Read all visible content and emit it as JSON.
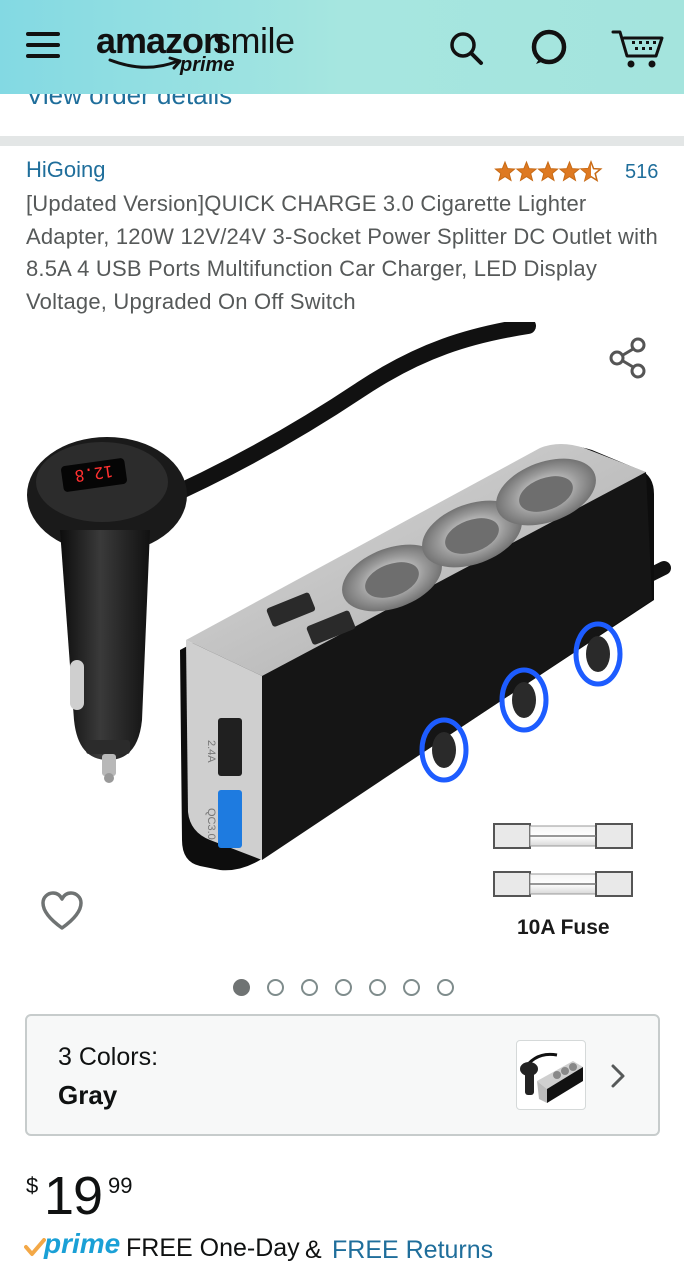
{
  "header": {
    "logo_main": "amazon",
    "logo_smile": "smile",
    "logo_prime": "prime",
    "background": "#a6e6e0",
    "icons": [
      "hamburger-menu-icon",
      "search-icon",
      "alexa-icon",
      "cart-icon"
    ]
  },
  "order_link": "View order details",
  "product": {
    "brand": "HiGoing",
    "rating": 4.5,
    "rating_count": "516",
    "title": "[Updated Version]QUICK CHARGE 3.0 Cigarette Lighter Adapter, 120W 12V/24V 3-Socket Power Splitter DC Outlet with 8.5A 4 USB Ports Multifunction Car Charger, LED Display Voltage, Upgraded On Off Switch"
  },
  "image": {
    "display_reading": "12.8",
    "port_label_1": "QC3.0",
    "port_label_2": "2.4A",
    "fuse_label": "10A Fuse",
    "carousel_count": 7,
    "carousel_active": 0
  },
  "color_selector": {
    "label": "3 Colors:",
    "value": "Gray"
  },
  "price": {
    "symbol": "$",
    "whole": "19",
    "fraction": "99"
  },
  "delivery": {
    "prime": "prime",
    "free_oneday": "FREE One-Day",
    "amp": "&",
    "free_returns": "FREE Returns"
  },
  "colors": {
    "link": "#1f6e9b",
    "star": "#de7921",
    "prime": "#1aa0d6",
    "text_secondary": "#565959"
  }
}
